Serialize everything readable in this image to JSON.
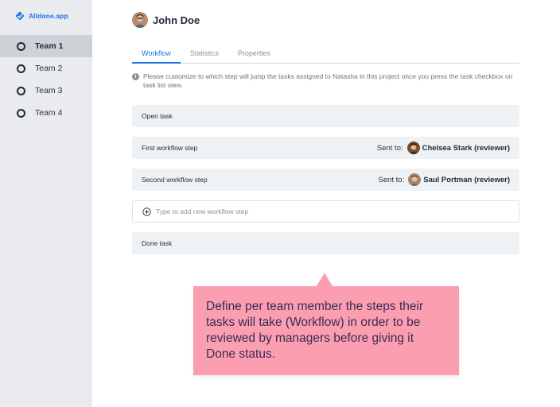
{
  "brand": {
    "name": "Alldone.app",
    "icon": "diamond-logo-icon",
    "color": "#1a73e8"
  },
  "sidebar": {
    "items": [
      {
        "label": "Team 1",
        "active": true
      },
      {
        "label": "Team 2",
        "active": false
      },
      {
        "label": "Team 3",
        "active": false
      },
      {
        "label": "Team 4",
        "active": false
      }
    ]
  },
  "profile": {
    "name": "John Doe",
    "avatar": "user-avatar-icon"
  },
  "tabs": [
    {
      "label": "Workflow",
      "active": true
    },
    {
      "label": "Statistics",
      "active": false
    },
    {
      "label": "Properties",
      "active": false
    }
  ],
  "info": {
    "icon": "info-icon",
    "text": "Please customize to which step will jump the tasks assigned to Natasha in this project once you press the task checkbox on task list view."
  },
  "workflow": {
    "open_task": "Open task",
    "steps": [
      {
        "label": "First workflow step",
        "sent_to_label": "Sent to:",
        "reviewer": "Chelsea Stark (reviewer)"
      },
      {
        "label": "Second workflow step",
        "sent_to_label": "Sent to:",
        "reviewer": "Saul Portman (reviewer)"
      }
    ],
    "add_placeholder": "Type to add new workflow step",
    "done_task": "Done task"
  },
  "callout": {
    "text": "Define per team member the steps their tasks will take (Workflow) in order to be reviewed by managers before giving it Done status.",
    "color": "#fb9fb0"
  },
  "colors": {
    "accent": "#1a73e8",
    "sidebar_bg": "#e9ebee",
    "row_bg": "#eff2f5"
  }
}
